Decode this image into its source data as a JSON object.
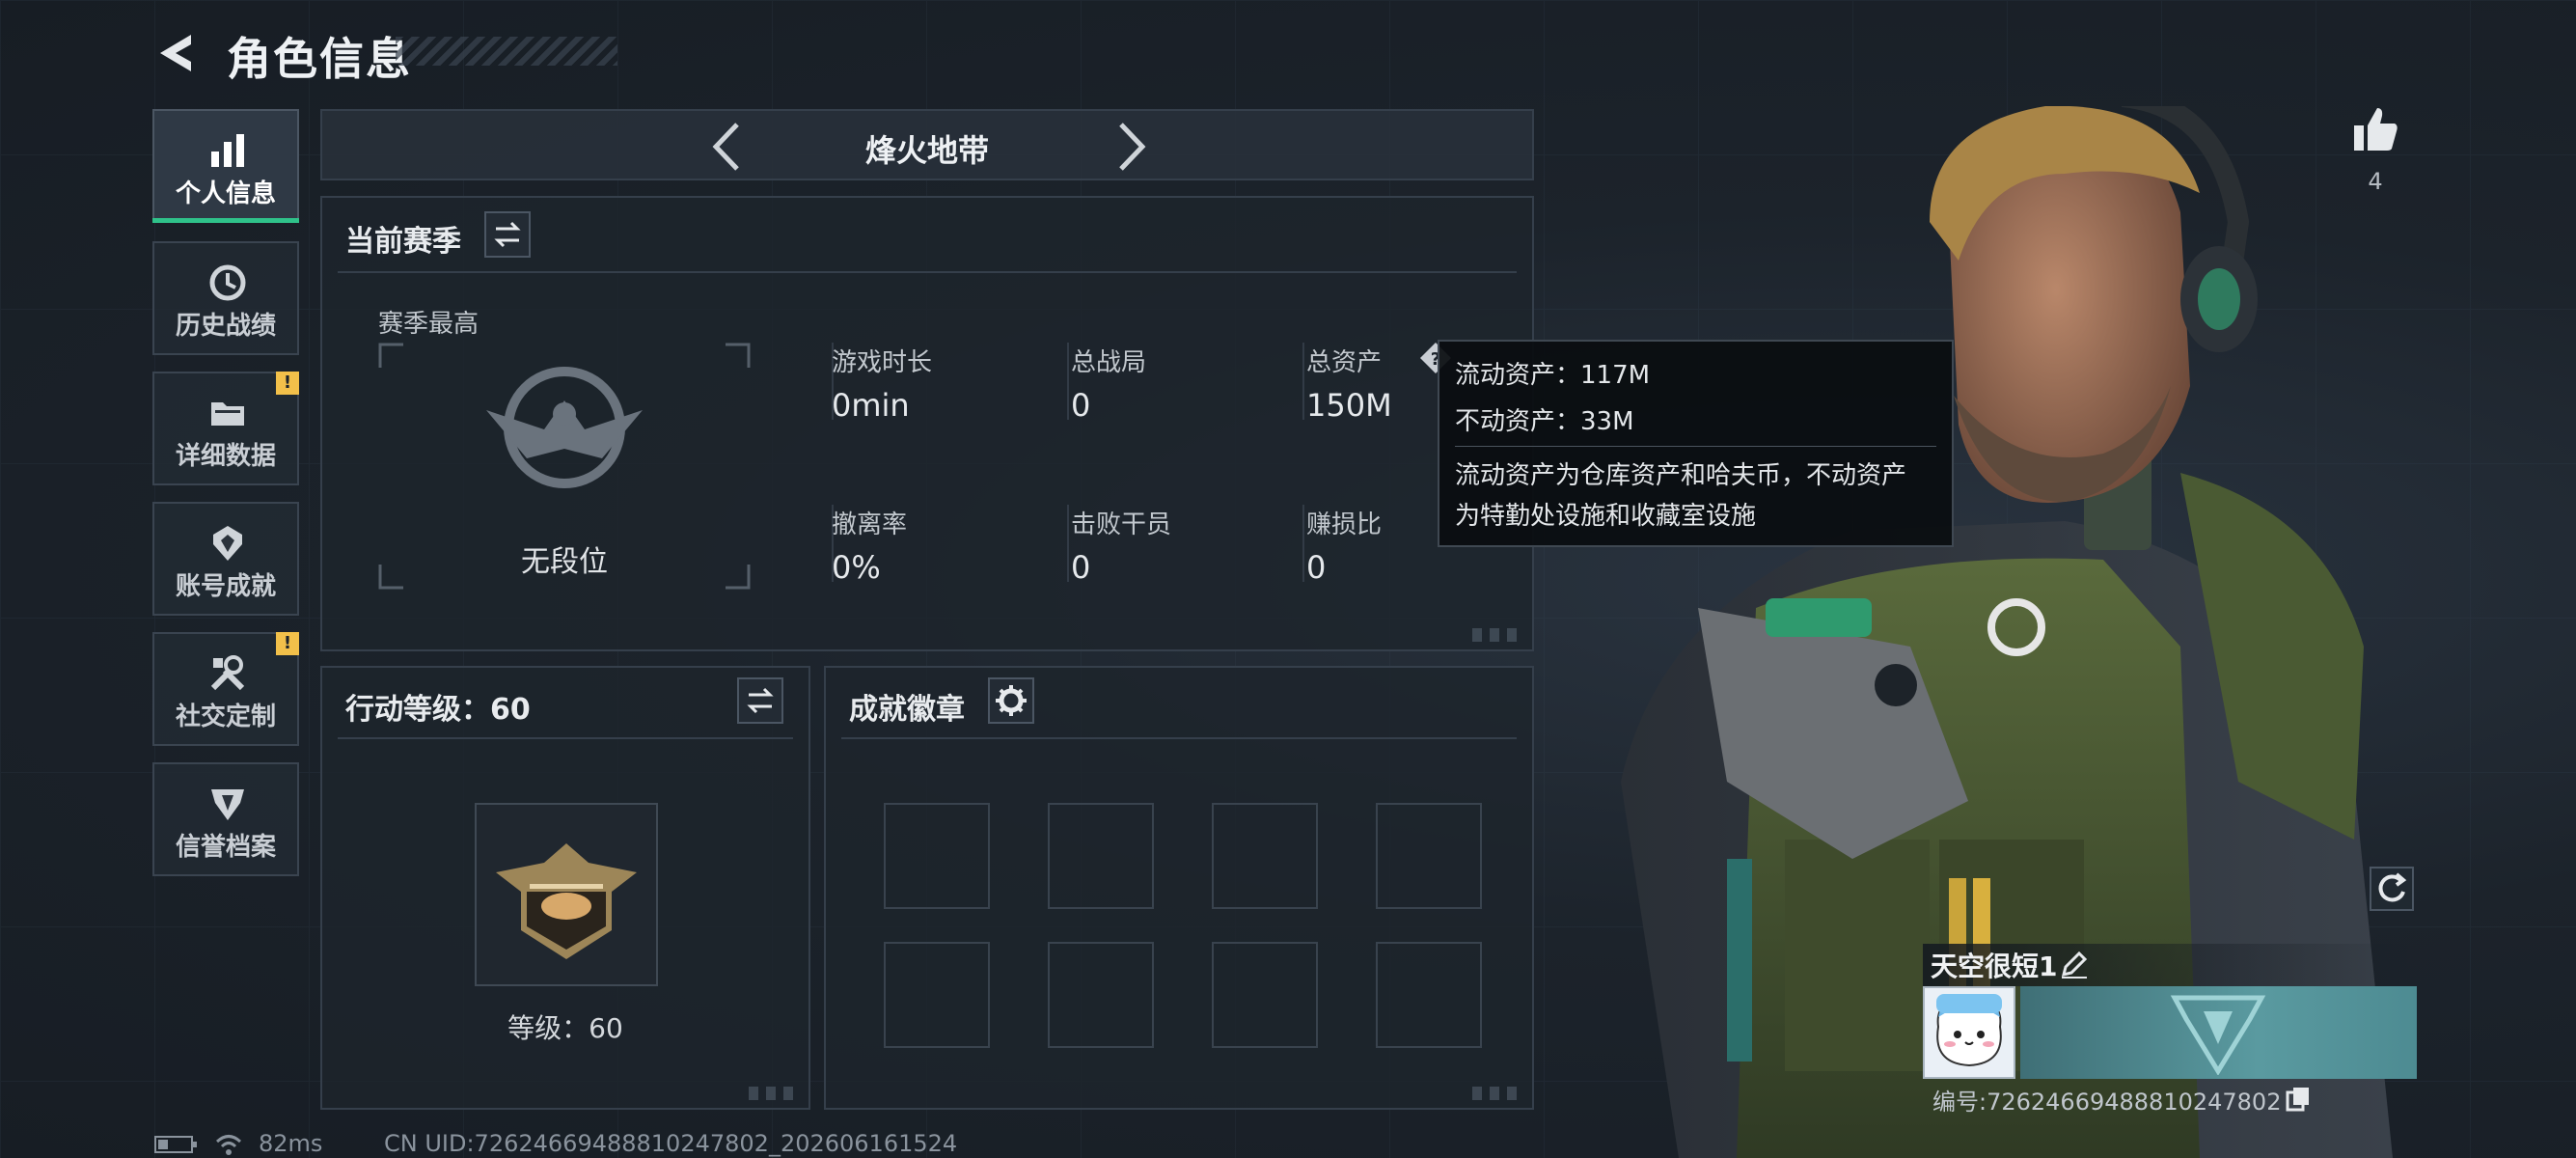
{
  "header": {
    "title": "角色信息"
  },
  "sidebar": {
    "items": [
      {
        "label": "个人信息",
        "icon": "bar-chart-icon",
        "active": true,
        "alert": false
      },
      {
        "label": "历史战绩",
        "icon": "history-clock-icon",
        "active": false,
        "alert": false
      },
      {
        "label": "详细数据",
        "icon": "folder-icon",
        "active": false,
        "alert": true
      },
      {
        "label": "账号成就",
        "icon": "achievement-icon",
        "active": false,
        "alert": false
      },
      {
        "label": "社交定制",
        "icon": "tools-icon",
        "active": false,
        "alert": true
      },
      {
        "label": "信誉档案",
        "icon": "reputation-icon",
        "active": false,
        "alert": false
      }
    ],
    "alert_mark": "!"
  },
  "mode_selector": {
    "label": "烽火地带"
  },
  "season": {
    "title": "当前赛季",
    "best_label": "赛季最高",
    "rank": "无段位",
    "stats": [
      {
        "label": "游戏时长",
        "value": "0min"
      },
      {
        "label": "总战局",
        "value": "0"
      },
      {
        "label": "总资产",
        "value": "150M"
      },
      {
        "label": "撤离率",
        "value": "0%"
      },
      {
        "label": "击败干员",
        "value": "0"
      },
      {
        "label": "赚损比",
        "value": "0"
      }
    ]
  },
  "tooltip": {
    "line1": "流动资产：117M",
    "line2": "不动资产：33M",
    "desc1": "流动资产为仓库资产和哈夫币，不动资产",
    "desc2": "为特勤处设施和收藏室设施"
  },
  "action_level": {
    "title": "行动等级：60",
    "level_text": "等级：60"
  },
  "achievements": {
    "title": "成就徽章",
    "slots": 8
  },
  "profile": {
    "likes": "4",
    "name": "天空很短1",
    "id_text": "编号:7262466948881024780​2"
  },
  "status_bar": {
    "ping": "82ms",
    "uid": "CN UID:7262466948881024780​2_202606161524"
  },
  "colors": {
    "accent": "#2fc28a",
    "alert": "#f2c04a",
    "panel_border": "#353f4b"
  }
}
